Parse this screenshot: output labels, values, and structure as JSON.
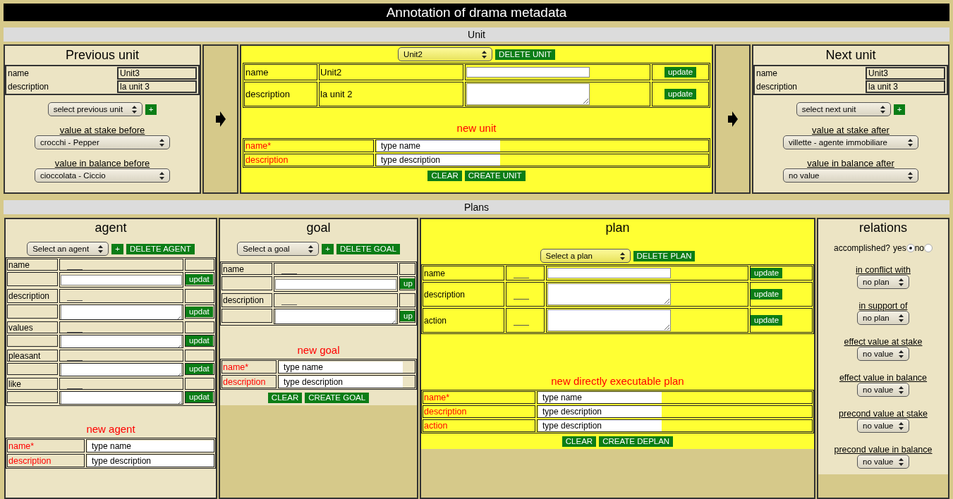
{
  "window": {
    "title": "Annotation of drama metadata"
  },
  "unit_section": {
    "title": "Unit",
    "previous_unit": {
      "title": "Previous unit",
      "fields": [
        {
          "label": "name",
          "value": "Unit3"
        },
        {
          "label": "description",
          "value": "la unit 3"
        }
      ],
      "select": "select previous unit",
      "add_button": "+",
      "selects": [
        {
          "label": "value at stake before",
          "value": "crocchi - Pepper"
        },
        {
          "label": "value in balance before",
          "value": "cioccolata - Ciccio"
        }
      ]
    },
    "current_unit": {
      "select": "Unit2",
      "delete_button": "DELETE UNIT",
      "fields": [
        {
          "label": "name",
          "value": "Unit2",
          "kind": "input",
          "button": "update"
        },
        {
          "label": "description",
          "value": "la unit 2",
          "kind": "textarea",
          "button": "update"
        }
      ],
      "new_title": "new unit",
      "new_fields": [
        {
          "label": "name*",
          "placeholder": "type name"
        },
        {
          "label": "description",
          "placeholder": "type description"
        }
      ],
      "buttons": [
        "CLEAR",
        "CREATE UNIT"
      ]
    },
    "next_unit": {
      "title": "Next unit",
      "fields": [
        {
          "label": "name",
          "value": "Unit3"
        },
        {
          "label": "description",
          "value": "la unit 3"
        }
      ],
      "select": "select next unit",
      "add_button": "+",
      "selects": [
        {
          "label": "value at stake after",
          "value": "villette - agente immobiliare"
        },
        {
          "label": "value in balance after",
          "value": "no value"
        }
      ]
    }
  },
  "plans_section": {
    "title": "Plans",
    "agent": {
      "title": "agent",
      "select": "Select an agent",
      "add_button": "+",
      "delete_button": "DELETE AGENT",
      "fields": [
        {
          "label": "name",
          "kind": "input",
          "button": "updat"
        },
        {
          "label": "description",
          "kind": "textarea",
          "button": "updat"
        },
        {
          "label": "values",
          "kind": "textarea",
          "button": "updat"
        },
        {
          "label": "pleasant",
          "kind": "textarea",
          "button": "updat"
        },
        {
          "label": "like",
          "kind": "textarea",
          "button": "updat"
        }
      ],
      "new_title": "new agent",
      "new_fields": [
        {
          "label": "name*",
          "placeholder": "type name"
        },
        {
          "label": "description",
          "placeholder": "type description"
        }
      ]
    },
    "goal": {
      "title": "goal",
      "select": "Select a goal",
      "add_button": "+",
      "delete_button": "DELETE GOAL",
      "fields": [
        {
          "label": "name",
          "kind": "input",
          "button": "up"
        },
        {
          "label": "description",
          "kind": "textarea",
          "button": "up"
        }
      ],
      "new_title": "new goal",
      "new_fields": [
        {
          "label": "name*",
          "placeholder": "type name"
        },
        {
          "label": "description",
          "placeholder": "type description"
        }
      ],
      "buttons": [
        "CLEAR",
        "CREATE GOAL"
      ]
    },
    "plan": {
      "title": "plan",
      "select": "Select a plan",
      "delete_button": "DELETE PLAN",
      "fields": [
        {
          "label": "name",
          "kind": "input",
          "button": "update"
        },
        {
          "label": "description",
          "kind": "textarea",
          "button": "update"
        },
        {
          "label": "action",
          "kind": "textarea",
          "button": "update"
        }
      ],
      "new_title": "new directly executable plan",
      "new_fields": [
        {
          "label": "name*",
          "placeholder": "type name"
        },
        {
          "label": "description",
          "placeholder": "type description"
        },
        {
          "label": "action",
          "placeholder": "type description"
        }
      ],
      "buttons": [
        "CLEAR",
        "CREATE DEPLAN"
      ]
    },
    "relations": {
      "title": "relations",
      "accomplished": {
        "label": "accomplished?",
        "options": [
          {
            "label": "yes",
            "selected": true
          },
          {
            "label": "no",
            "selected": false
          }
        ]
      },
      "selects": [
        {
          "label": "in conflict with",
          "value": "no plan"
        },
        {
          "label": "in support of",
          "value": "no plan"
        },
        {
          "label": "effect value at stake",
          "value": "no value"
        },
        {
          "label": "effect value in balance",
          "value": "no value"
        },
        {
          "label": "precond value at stake",
          "value": "no value"
        },
        {
          "label": "precond value in balance",
          "value": "no value"
        }
      ]
    }
  }
}
